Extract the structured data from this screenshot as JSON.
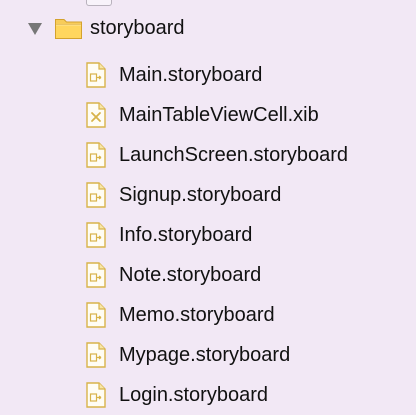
{
  "folder": {
    "label": "storyboard",
    "icon": "folder-icon",
    "disclosure_icon": "chevron-down-icon"
  },
  "files": [
    {
      "label": "Main.storyboard",
      "icon": "storyboard-file-icon"
    },
    {
      "label": "MainTableViewCell.xib",
      "icon": "xib-file-icon"
    },
    {
      "label": "LaunchScreen.storyboard",
      "icon": "storyboard-file-icon"
    },
    {
      "label": "Signup.storyboard",
      "icon": "storyboard-file-icon"
    },
    {
      "label": "Info.storyboard",
      "icon": "storyboard-file-icon"
    },
    {
      "label": "Note.storyboard",
      "icon": "storyboard-file-icon"
    },
    {
      "label": "Memo.storyboard",
      "icon": "storyboard-file-icon"
    },
    {
      "label": "Mypage.storyboard",
      "icon": "storyboard-file-icon"
    },
    {
      "label": "Login.storyboard",
      "icon": "storyboard-file-icon"
    }
  ],
  "colors": {
    "background": "#f2e8f5",
    "text": "#111111",
    "folder_yellow": "#f4c24b",
    "file_stroke": "#d8b34a",
    "disclosure": "#777777"
  }
}
